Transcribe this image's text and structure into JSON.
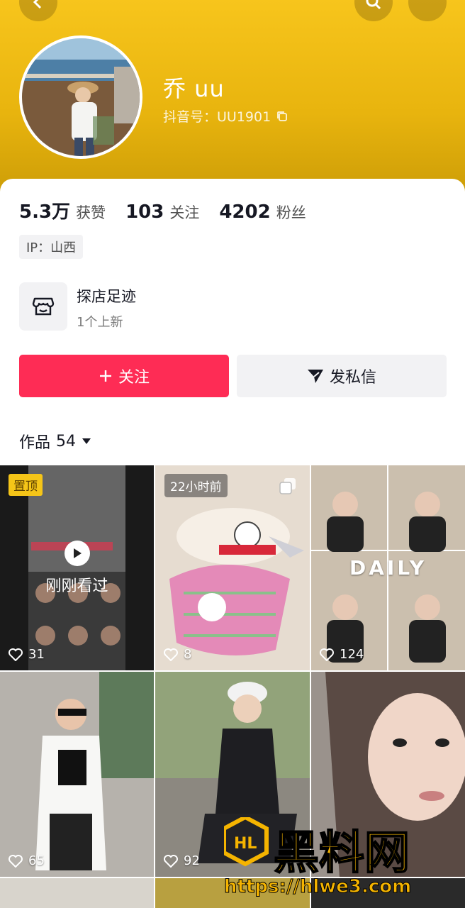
{
  "profile": {
    "nickname": "乔 uu",
    "douyin_id": "抖音号：UU1901"
  },
  "stats": [
    {
      "value": "5.3万",
      "label": "获赞"
    },
    {
      "value": "103",
      "label": "关注"
    },
    {
      "value": "4202",
      "label": "粉丝"
    }
  ],
  "ip": "IP：山西",
  "store": {
    "title": "探店足迹",
    "subtitle": "1个上新"
  },
  "actions": {
    "follow": "关注",
    "message": "发私信"
  },
  "works_tab": {
    "label": "作品",
    "count": "54"
  },
  "grid": [
    {
      "pinned_label": "置顶",
      "overlay": "刚刚看过",
      "likes": "31"
    },
    {
      "time_label": "22小时前",
      "likes": "8"
    },
    {
      "caption": "DAILY",
      "likes": "124"
    },
    {
      "likes": "65"
    },
    {
      "likes": "92"
    },
    {
      "likes": ""
    }
  ],
  "watermark": {
    "text": "黑料网",
    "url": "https://hlwe3.com"
  },
  "colors": {
    "accent": "#fe2c55",
    "header": "#f7c51c"
  }
}
